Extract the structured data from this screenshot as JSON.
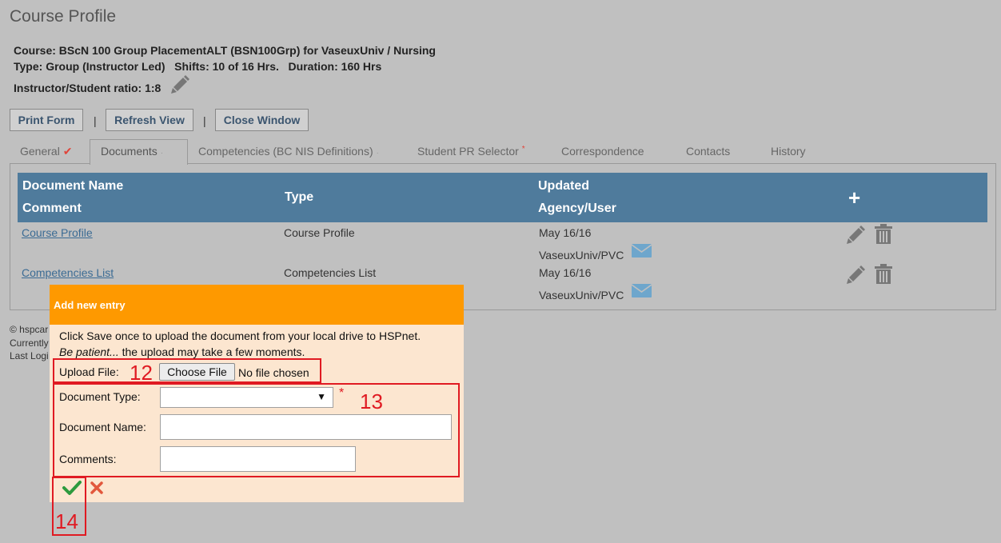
{
  "page": {
    "title": "Course Profile"
  },
  "course": {
    "line1": "Course: BScN 100 Group PlacementALT (BSN100Grp) for VaseuxUniv / Nursing",
    "line2": "Type: Group (Instructor Led)   Shifts: 10 of 16 Hrs.   Duration: 160 Hrs",
    "line3": "Instructor/Student ratio: 1:8"
  },
  "toolbar": {
    "print_label": "Print Form",
    "refresh_label": "Refresh View",
    "close_label": "Close Window",
    "separator": "|"
  },
  "tabs": [
    {
      "label": "General",
      "marker": "✔"
    },
    {
      "label": "Documents",
      "marker": "·"
    },
    {
      "label": "Competencies (BC NIS Definitions)",
      "marker": "·"
    },
    {
      "label": "Student PR Selector",
      "marker": "*"
    },
    {
      "label": "Correspondence"
    },
    {
      "label": "Contacts"
    },
    {
      "label": "History"
    }
  ],
  "table": {
    "headers": {
      "doc_name": "Document Name",
      "comment": "Comment",
      "type": "Type",
      "updated": "Updated",
      "agency_user": "Agency/User",
      "add": "+"
    },
    "rows": [
      {
        "name": "Course Profile",
        "type": "Course Profile",
        "date": "May 16/16",
        "user": "VaseuxUniv/PVC"
      },
      {
        "name": "Competencies List",
        "type": "Competencies List",
        "date": "May 16/16",
        "user": "VaseuxUniv/PVC"
      }
    ]
  },
  "footer": {
    "line1": "© hspcar",
    "line2": "Currently",
    "line3": "Last Logi"
  },
  "modal": {
    "title": "Add new entry",
    "instructions1": "Click Save once to upload the document from your local drive to HSPnet.",
    "instructions2_em": "Be patient...",
    "instructions2_rest": " the upload may take a few moments.",
    "upload_label": "Upload File:",
    "choose_file": "Choose File",
    "no_file": "No file chosen",
    "doc_type_label": "Document Type:",
    "doc_type_value": "",
    "required_mark": "*",
    "doc_name_label": "Document Name:",
    "doc_name_value": "",
    "comments_label": "Comments:",
    "comments_value": ""
  },
  "annotations": {
    "a12": "12",
    "a13": "13",
    "a14": "14"
  },
  "colors": {
    "background": "#c0c0c0",
    "table_header": "#4f7b9c",
    "modal_header": "#fe9900",
    "modal_body": "#fce6d0",
    "annotation_red": "#e01a22",
    "save_green": "#2e9a3e",
    "cancel_red": "#e2573c",
    "mail_blue": "#6ea6cc"
  }
}
